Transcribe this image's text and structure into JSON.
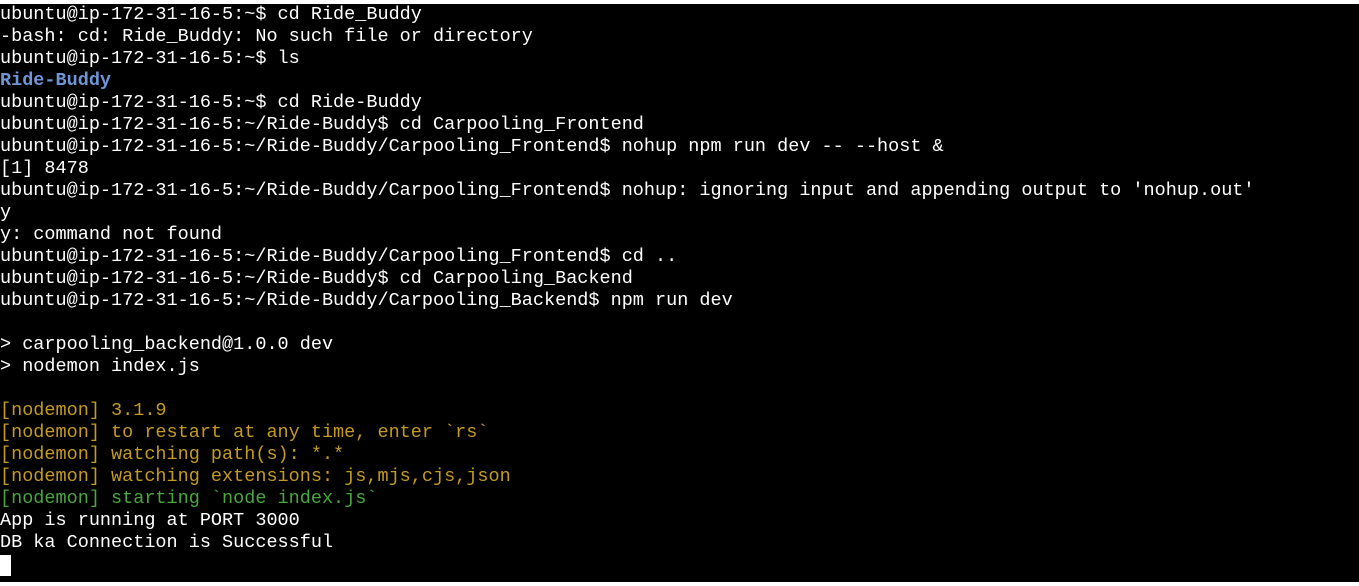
{
  "terminal": {
    "lines": [
      "ubuntu@ip-172-31-16-5:~$ cd Ride_Buddy",
      "-bash: cd: Ride_Buddy: No such file or directory",
      "ubuntu@ip-172-31-16-5:~$ ls",
      "Ride-Buddy",
      "ubuntu@ip-172-31-16-5:~$ cd Ride-Buddy",
      "ubuntu@ip-172-31-16-5:~/Ride-Buddy$ cd Carpooling_Frontend",
      "ubuntu@ip-172-31-16-5:~/Ride-Buddy/Carpooling_Frontend$ nohup npm run dev -- --host &",
      "[1] 8478",
      "ubuntu@ip-172-31-16-5:~/Ride-Buddy/Carpooling_Frontend$ nohup: ignoring input and appending output to 'nohup.out'",
      "y",
      "y: command not found",
      "ubuntu@ip-172-31-16-5:~/Ride-Buddy/Carpooling_Frontend$ cd ..",
      "ubuntu@ip-172-31-16-5:~/Ride-Buddy$ cd Carpooling_Backend",
      "ubuntu@ip-172-31-16-5:~/Ride-Buddy/Carpooling_Backend$ npm run dev",
      "",
      "> carpooling_backend@1.0.0 dev",
      "> nodemon index.js",
      "",
      "[nodemon] 3.1.9",
      "[nodemon] to restart at any time, enter `rs`",
      "[nodemon] watching path(s): *.*",
      "[nodemon] watching extensions: js,mjs,cjs,json",
      "[nodemon] starting `node index.js`",
      "App is running at PORT 3000",
      "DB ka Connection is Successful"
    ],
    "colors": {
      "background": "#000000",
      "text": "#ffffff",
      "directory": "#6f95d6",
      "nodemon_yellow": "#c49a22",
      "nodemon_green": "#48a83e"
    }
  }
}
